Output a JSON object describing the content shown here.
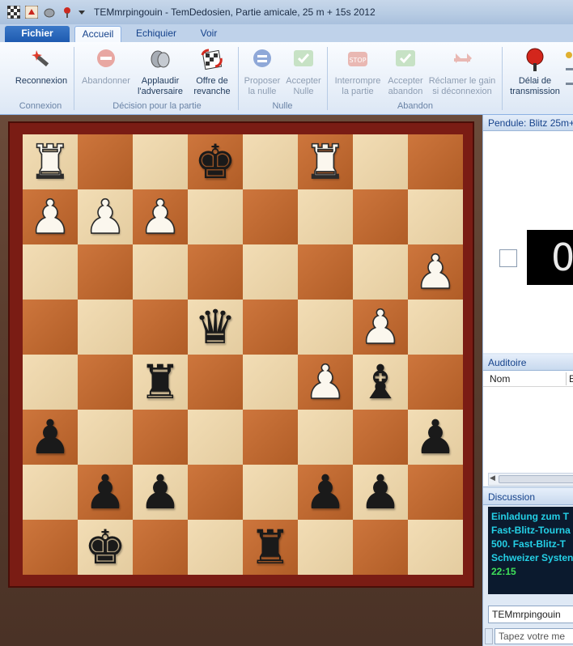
{
  "window": {
    "title": "TEMmrpingouin - TemDedosien, Partie amicale, 25 m + 15s 2012"
  },
  "ribbon_tabs": {
    "file": "Fichier",
    "home": "Accueil",
    "chessboard": "Echiquier",
    "view": "Voir"
  },
  "ribbon": {
    "reconnect": "Reconnexion",
    "resign": "Abandonner",
    "applaud_1": "Applaudir",
    "applaud_2": "l'adversaire",
    "rematch_1": "Offre de",
    "rematch_2": "revanche",
    "propose_draw_1": "Proposer",
    "propose_draw_2": "la nulle",
    "accept_draw_1": "Accepter",
    "accept_draw_2": "Nulle",
    "interrupt_1": "Interrompre",
    "interrupt_2": "la partie",
    "accept_resign_1": "Accepter",
    "accept_resign_2": "abandon",
    "claim_win_1": "Réclamer le gain",
    "claim_win_2": "si déconnexion",
    "transmission_1": "Délai de",
    "transmission_2": "transmission",
    "group_connection": "Connexion",
    "group_decision": "Décision pour la partie",
    "group_draw": "Nulle",
    "group_resign": "Abandon"
  },
  "board": {
    "light_color": "#f0d7a8",
    "dark_color": "#c96a2c",
    "ranks": [
      [
        "wR",
        "",
        "",
        "bK",
        "",
        "wR",
        "",
        ""
      ],
      [
        "wP",
        "wP",
        "wP",
        "",
        "",
        "",
        "",
        ""
      ],
      [
        "",
        "",
        "",
        "",
        "",
        "",
        "",
        "wP"
      ],
      [
        "",
        "",
        "",
        "bQ",
        "",
        "",
        "wP",
        ""
      ],
      [
        "",
        "",
        "bR",
        "",
        "",
        "wP",
        "bB",
        ""
      ],
      [
        "bP",
        "",
        "",
        "",
        "",
        "",
        "",
        "bP"
      ],
      [
        "",
        "bP",
        "bP",
        "",
        "",
        "bP",
        "bP",
        ""
      ],
      [
        "",
        "bK",
        "",
        "",
        "bR",
        "",
        "",
        ""
      ]
    ]
  },
  "clock": {
    "header": "Pendule: Blitz 25m+1",
    "display": "0"
  },
  "audience": {
    "header": "Auditoire",
    "col_name": "Nom",
    "col_2": "E"
  },
  "discussion": {
    "header": "Discussion",
    "lines": [
      "Einladung zum T",
      "Fast-Blitz-Tourna",
      "500. Fast-Blitz-T",
      "Schweizer Systen",
      "22:15"
    ],
    "user": "TEMmrpingouin",
    "input_placeholder": "Tapez votre me"
  }
}
